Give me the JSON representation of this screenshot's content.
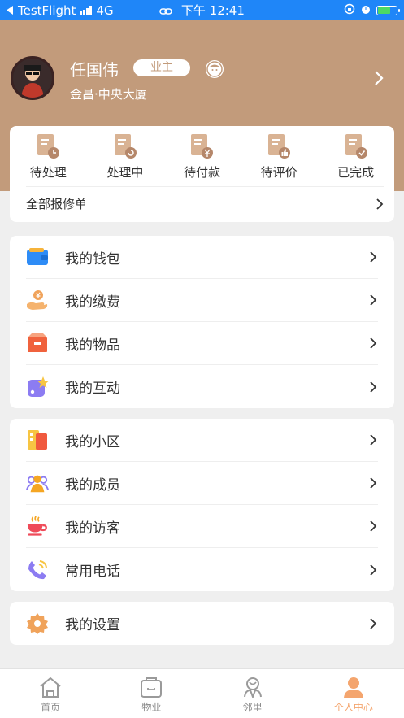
{
  "status_bar": {
    "back_app": "TestFlight",
    "network": "4G",
    "time": "下午 12:41"
  },
  "profile": {
    "name": "任国伟",
    "role": "业主",
    "address": "金昌·中央大厦"
  },
  "orders": {
    "items": [
      {
        "label": "待处理",
        "icon": "pending-order-icon"
      },
      {
        "label": "处理中",
        "icon": "processing-order-icon"
      },
      {
        "label": "待付款",
        "icon": "unpaid-order-icon"
      },
      {
        "label": "待评价",
        "icon": "to-review-order-icon"
      },
      {
        "label": "已完成",
        "icon": "completed-order-icon"
      }
    ],
    "all_label": "全部报修单"
  },
  "menu_group_1": [
    {
      "label": "我的钱包",
      "icon": "wallet-icon"
    },
    {
      "label": "我的缴费",
      "icon": "payment-icon"
    },
    {
      "label": "我的物品",
      "icon": "items-box-icon"
    },
    {
      "label": "我的互动",
      "icon": "interaction-icon"
    }
  ],
  "menu_group_2": [
    {
      "label": "我的小区",
      "icon": "community-icon"
    },
    {
      "label": "我的成员",
      "icon": "members-icon"
    },
    {
      "label": "我的访客",
      "icon": "visitor-cup-icon"
    },
    {
      "label": "常用电话",
      "icon": "phone-icon"
    }
  ],
  "menu_group_3": [
    {
      "label": "我的设置",
      "icon": "settings-gear-icon"
    }
  ],
  "tabbar": [
    {
      "label": "首页",
      "icon": "home-icon",
      "active": false
    },
    {
      "label": "物业",
      "icon": "property-icon",
      "active": false
    },
    {
      "label": "邻里",
      "icon": "neighbor-icon",
      "active": false
    },
    {
      "label": "个人中心",
      "icon": "profile-icon",
      "active": true
    }
  ],
  "colors": {
    "status_bar": "#1f86f8",
    "header": "#c29b7b",
    "accent": "#f4a56e"
  }
}
